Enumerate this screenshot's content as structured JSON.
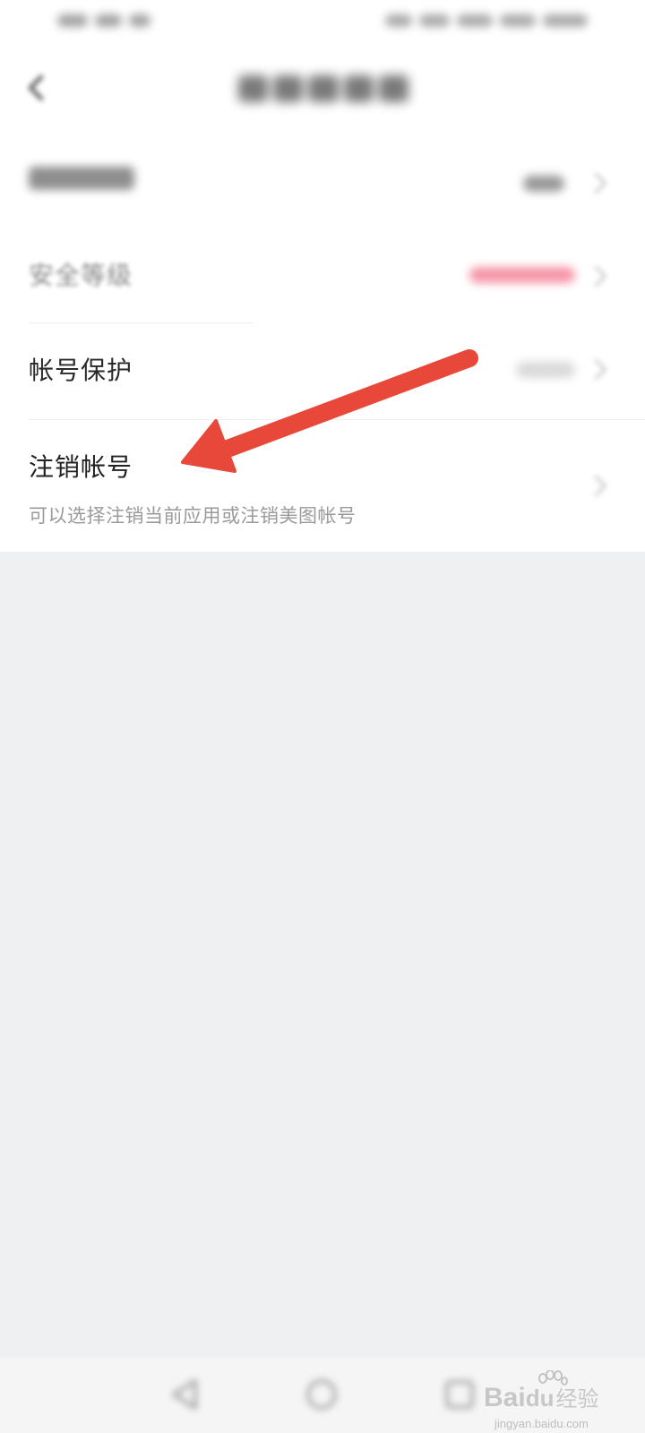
{
  "status_bar": {
    "left_text": "",
    "right_text": ""
  },
  "nav": {
    "title": ""
  },
  "rows": {
    "row1": {
      "label": "",
      "value": ""
    },
    "security_level": {
      "label": "安全等级",
      "value": ""
    },
    "account_protection": {
      "label": "帐号保护",
      "value": ""
    },
    "cancel_account": {
      "label": "注销帐号",
      "description": "可以选择注销当前应用或注销美图帐号"
    }
  },
  "watermark": {
    "brand_prefix": "Bai",
    "brand_suffix": "du",
    "brand_cn": "经验",
    "url": "jingyan.baidu.com"
  },
  "colors": {
    "arrow": "#e8483a",
    "security_value": "#f0506e",
    "page_bg": "#eff0f2",
    "card_bg": "#ffffff"
  },
  "icons": {
    "back": "chevron-left-icon",
    "row_chevron": "chevron-right-icon",
    "bottom_back": "triangle-back-icon",
    "bottom_home": "circle-home-icon",
    "bottom_recent": "square-recent-icon"
  }
}
